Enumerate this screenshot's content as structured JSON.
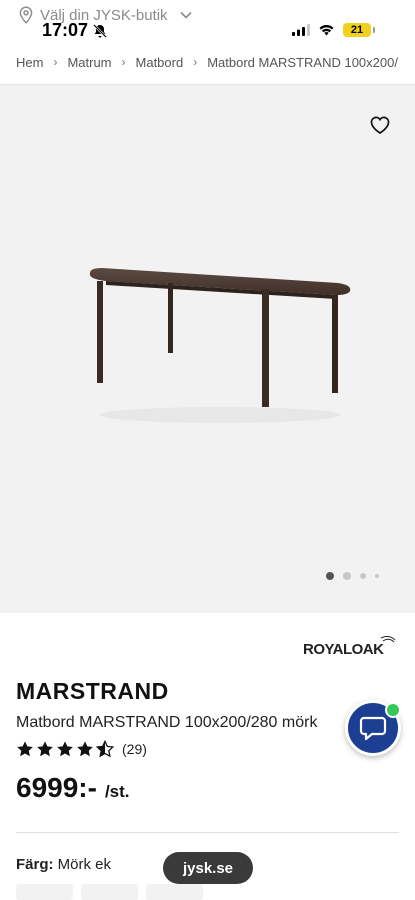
{
  "status": {
    "time": "17:07",
    "battery": "21"
  },
  "store": {
    "label": "Välj din JYSK-butik"
  },
  "breadcrumb": [
    "Hem",
    "Matrum",
    "Matbord",
    "Matbord MARSTRAND 100x200/"
  ],
  "gallery": {
    "dots": 4,
    "active_index": 0
  },
  "brand": {
    "name": "ROYALOAK"
  },
  "product": {
    "title": "MARSTRAND",
    "subtitle": "Matbord MARSTRAND 100x200/280 mörk",
    "rating": 4.5,
    "rating_max": 5,
    "rating_count": "(29)",
    "price": "6999:-",
    "price_unit": "/st."
  },
  "color": {
    "label": "Färg:",
    "value": "Mörk ek"
  },
  "browser": {
    "url": "jysk.se"
  },
  "colors": {
    "chat_fab": "#1c3f94",
    "chat_badge": "#34c759",
    "battery": "#f2d01e"
  }
}
